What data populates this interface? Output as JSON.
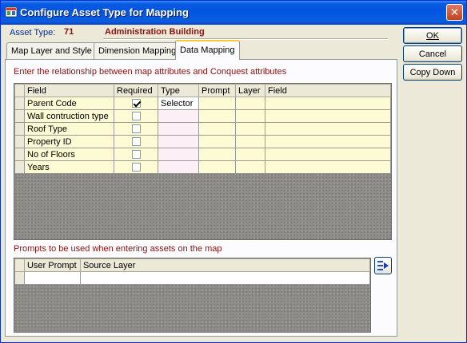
{
  "window": {
    "title": "Configure Asset Type for Mapping"
  },
  "header": {
    "asset_type_label": "Asset Type:",
    "asset_type_value": "71",
    "asset_name": "Administration Building"
  },
  "tabs": [
    {
      "label": "Map Layer and Style",
      "active": false
    },
    {
      "label": "Dimension Mapping",
      "active": false
    },
    {
      "label": "Data Mapping",
      "active": true
    }
  ],
  "mapping": {
    "instruction": "Enter the relationship between map attributes and Conquest attributes",
    "columns": [
      "Field",
      "Required",
      "Type",
      "Prompt",
      "Layer",
      "Field"
    ],
    "rows": [
      {
        "field": "Parent Code",
        "required": true,
        "type": "Selector",
        "prompt": "",
        "layer": "",
        "field2": ""
      },
      {
        "field": "Wall contruction type",
        "required": false,
        "type": "",
        "prompt": "",
        "layer": "",
        "field2": ""
      },
      {
        "field": "Roof Type",
        "required": false,
        "type": "",
        "prompt": "",
        "layer": "",
        "field2": ""
      },
      {
        "field": "Property ID",
        "required": false,
        "type": "",
        "prompt": "",
        "layer": "",
        "field2": ""
      },
      {
        "field": "No of Floors",
        "required": false,
        "type": "",
        "prompt": "",
        "layer": "",
        "field2": ""
      },
      {
        "field": "Years",
        "required": false,
        "type": "",
        "prompt": "",
        "layer": "",
        "field2": ""
      }
    ]
  },
  "prompts": {
    "instruction": "Prompts to be used when entering assets on the map",
    "columns": [
      "User Prompt",
      "Source Layer"
    ]
  },
  "buttons": {
    "ok": "OK",
    "cancel": "Cancel",
    "copy_down": "Copy Down"
  },
  "icons": {
    "title_icon": "app-icon",
    "close": "close-icon",
    "side": "arrow-insert-icon"
  }
}
